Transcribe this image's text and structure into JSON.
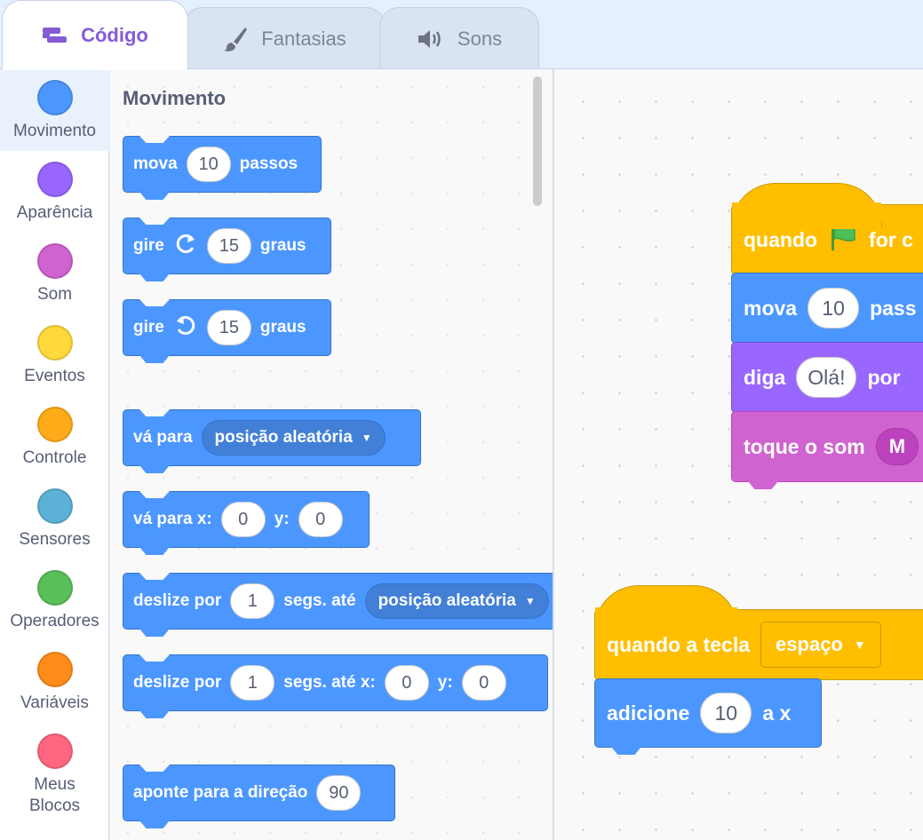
{
  "tabs": [
    {
      "label": "Código",
      "icon": "code-icon",
      "active": true
    },
    {
      "label": "Fantasias",
      "icon": "brush-icon",
      "active": false
    },
    {
      "label": "Sons",
      "icon": "speaker-icon",
      "active": false
    }
  ],
  "categories": [
    {
      "label": "Movimento",
      "color": "#4c97ff"
    },
    {
      "label": "Aparência",
      "color": "#9966ff"
    },
    {
      "label": "Som",
      "color": "#cf63cf"
    },
    {
      "label": "Eventos",
      "color": "#ffd83b"
    },
    {
      "label": "Controle",
      "color": "#ffab19"
    },
    {
      "label": "Sensores",
      "color": "#5cb1d6"
    },
    {
      "label": "Operadores",
      "color": "#59c059"
    },
    {
      "label": "Variáveis",
      "color": "#ff8c1a"
    },
    {
      "label": "Meus",
      "label2": "Blocos",
      "color": "#ff6680"
    }
  ],
  "palette": {
    "title": "Movimento",
    "mova": {
      "a": "mova",
      "v": "10",
      "b": "passos"
    },
    "gire_right": {
      "a": "gire",
      "icon": "rotate-right-icon",
      "v": "15",
      "b": "graus"
    },
    "gire_left": {
      "a": "gire",
      "icon": "rotate-left-icon",
      "v": "15",
      "b": "graus"
    },
    "va_para": {
      "a": "vá para",
      "d": "posição aleatória"
    },
    "va_xy": {
      "a": "vá para x:",
      "x": "0",
      "yl": "y:",
      "y": "0"
    },
    "deslize1": {
      "a": "deslize por",
      "v": "1",
      "b": "segs. até",
      "d": "posição aleatória"
    },
    "deslize2": {
      "a": "deslize por",
      "v": "1",
      "b": "segs. até x:",
      "x": "0",
      "yl": "y:",
      "y": "0"
    },
    "aponte": {
      "a": "aponte para a direção",
      "v": "90"
    }
  },
  "workspace": {
    "script1": {
      "hat": {
        "a": "quando",
        "icon": "green-flag-icon",
        "b": "for c"
      },
      "mova": {
        "a": "mova",
        "v": "10",
        "b": "pass"
      },
      "diga": {
        "a": "diga",
        "v": "Olá!",
        "b": "por"
      },
      "toque": {
        "a": "toque o som",
        "v": "M"
      }
    },
    "script2": {
      "hat": {
        "a": "quando a tecla",
        "d": "espaço"
      },
      "adicione": {
        "a": "adicione",
        "v": "10",
        "b": "a x"
      }
    }
  }
}
